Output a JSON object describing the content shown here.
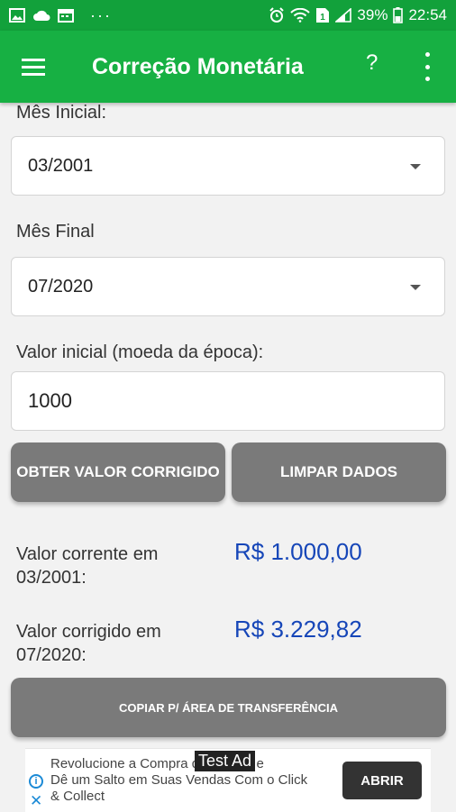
{
  "status_bar": {
    "icons_left": [
      "image-icon",
      "cloud-icon",
      "calendar-icon"
    ],
    "overflow": "···",
    "icons_right": [
      "alarm-icon",
      "wifi-icon",
      "sim-icon",
      "signal-icon"
    ],
    "battery": "39%",
    "time": "22:54"
  },
  "app_bar": {
    "title": "Correção Monetária",
    "help": "?"
  },
  "form": {
    "start_label": "Mês Inicial:",
    "start_value": "03/2001",
    "end_label": "Mês Final",
    "end_value": "07/2020",
    "amount_label": "Valor inicial (moeda da época):",
    "amount_value": "1000"
  },
  "buttons": {
    "compute": "OBTER VALOR CORRIGIDO",
    "clear": "LIMPAR DADOS",
    "copy": "COPIAR P/ ÁREA DE TRANSFERÊNCIA"
  },
  "results": {
    "current_label_line1": "Valor corrente em",
    "current_label_line2": "03/2001:",
    "current_value": "R$ 1.000,00",
    "corrected_label_line1": "Valor corrigido em",
    "corrected_label_line2": "07/2020:",
    "corrected_value": "R$ 3.229,82"
  },
  "ad": {
    "tag": "Test Ad",
    "line1": "Revolucione a Compra do Cliente e",
    "line2": "Dê um Salto em Suas Vendas Com o Click",
    "line3": "& Collect",
    "cta": "ABRIR"
  },
  "colors": {
    "status_bar": "#12a13b",
    "app_bar": "#17b043",
    "button": "#7a7a7a",
    "result_value": "#1646b8"
  }
}
